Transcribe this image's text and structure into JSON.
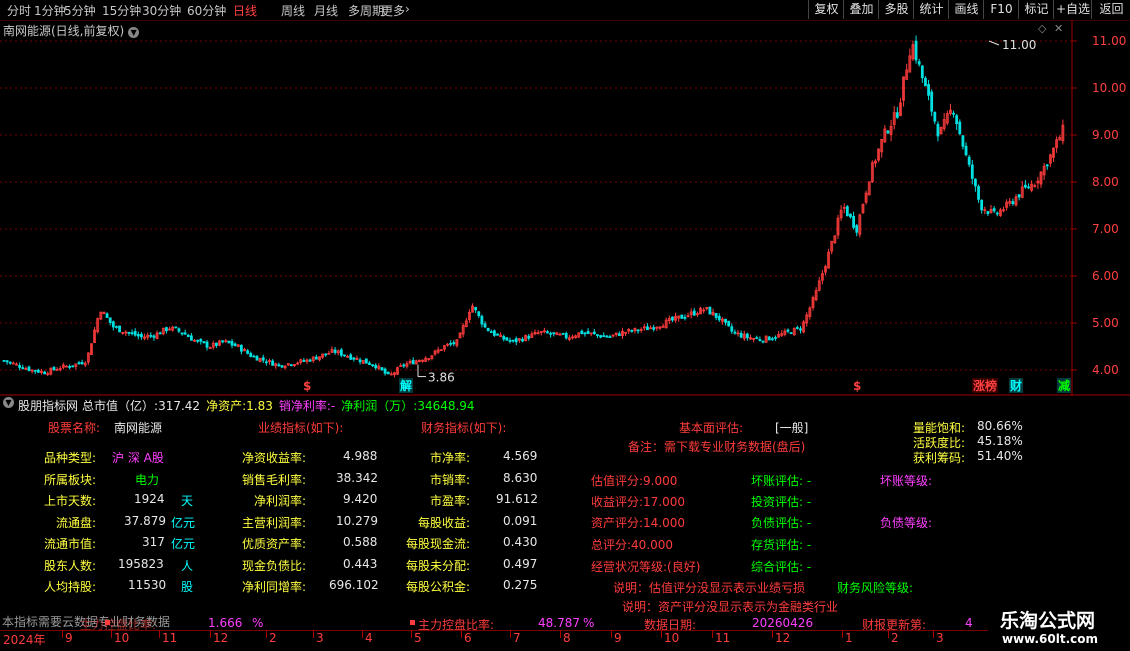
{
  "toolbar": {
    "periods": [
      "分时",
      "1分钟",
      "5分钟",
      "15分钟",
      "30分钟",
      "60分钟",
      "日线",
      "周线",
      "月线",
      "多周期",
      "更多"
    ],
    "selected": "日线",
    "buttons": [
      "复权",
      "叠加",
      "多股",
      "统计",
      "画线",
      "F10",
      "标记",
      "+自选",
      "返回"
    ]
  },
  "chart": {
    "title": "南网能源(日线,前复权)",
    "y_ticks": [
      "11.00",
      "10.00",
      "9.00",
      "8.00",
      "7.00",
      "6.00",
      "5.00",
      "4.00"
    ],
    "high_label": "11.00",
    "low_label": "3.86",
    "markers": [
      {
        "text": "$",
        "color": "#ff4040"
      },
      {
        "text": "解",
        "color": "#00ffff"
      },
      {
        "text": "$",
        "color": "#ff4040"
      },
      {
        "text": "涨榜",
        "color": "#ff4040"
      },
      {
        "text": "财",
        "color": "#00ffff"
      },
      {
        "text": "减",
        "color": "#00ff00"
      }
    ],
    "colors": {
      "up": "#ff3c3c",
      "down": "#00e0e0",
      "grid": "#7a0000",
      "axis": "#a00000"
    }
  },
  "chart_data": {
    "type": "candlestick",
    "title": "南网能源(日线,前复权)",
    "ylim": [
      3.7,
      11.2
    ],
    "approx_close_path": [
      4.2,
      4.1,
      4.0,
      3.95,
      4.05,
      4.1,
      4.2,
      5.3,
      4.9,
      4.8,
      4.7,
      4.75,
      4.9,
      4.8,
      4.6,
      4.5,
      4.6,
      4.5,
      4.3,
      4.2,
      4.1,
      4.15,
      4.2,
      4.3,
      4.4,
      4.3,
      4.2,
      4.1,
      3.86,
      4.1,
      4.2,
      4.3,
      4.5,
      4.6,
      5.4,
      4.9,
      4.7,
      4.6,
      4.7,
      4.8,
      4.75,
      4.7,
      4.8,
      4.75,
      4.7,
      4.8,
      4.85,
      4.9,
      5.0,
      5.1,
      5.2,
      5.3,
      5.1,
      4.8,
      4.7,
      4.65,
      4.7,
      4.8,
      4.9,
      5.6,
      6.5,
      7.5,
      7.0,
      8.2,
      9.0,
      9.5,
      11.0,
      10.0,
      9.0,
      9.6,
      8.5,
      7.5,
      7.3,
      7.5,
      7.8,
      8.0,
      8.5,
      9.1
    ]
  },
  "info": {
    "title": "股朋指标网",
    "header_pairs": [
      {
        "k": "总市值（亿）",
        "v": "317.42",
        "color": "#e8e8e8"
      },
      {
        "k": "净资产",
        "v": "1.83",
        "color": "#ffff40"
      },
      {
        "k": "销净利率",
        "v": "-",
        "color": "#ff40ff"
      },
      {
        "k": "净利润（万）",
        "v": "34648.94",
        "color": "#00ff00"
      }
    ],
    "stock_name_label": "股票名称:",
    "stock_name": "南网能源",
    "perf_header": "业绩指标(如下):",
    "fin_header": "财务指标(如下):",
    "fundamental_label": "基本面评估:",
    "fundamental_value": "[一般]",
    "note": "备注：需下载专业财务数据(盘后)",
    "left_rows": [
      {
        "k": "品种类型:",
        "v": "沪 深 A股",
        "u": ""
      },
      {
        "k": "所属板块:",
        "v": "电力",
        "u": ""
      },
      {
        "k": "上市天数:",
        "v": "1924",
        "u": "天"
      },
      {
        "k": "流通盘:",
        "v": "37.879",
        "u": "亿元"
      },
      {
        "k": "流通市值:",
        "v": "317",
        "u": "亿元"
      },
      {
        "k": "股东人数:",
        "v": "195823",
        "u": "人"
      },
      {
        "k": "人均持股:",
        "v": "11530",
        "u": "股"
      }
    ],
    "perf_rows": [
      {
        "k": "净资收益率:",
        "v": "4.988"
      },
      {
        "k": "销售毛利率:",
        "v": "38.342"
      },
      {
        "k": "净利润率:",
        "v": "9.420"
      },
      {
        "k": "主营利润率:",
        "v": "10.279"
      },
      {
        "k": "优质资产率:",
        "v": "0.588"
      },
      {
        "k": "现金负债比:",
        "v": "0.443"
      },
      {
        "k": "净利同增率:",
        "v": "696.102"
      }
    ],
    "fin_rows": [
      {
        "k": "市净率:",
        "v": "4.569"
      },
      {
        "k": "市销率:",
        "v": "8.630"
      },
      {
        "k": "市盈率:",
        "v": "91.612"
      },
      {
        "k": "每股收益:",
        "v": "0.091"
      },
      {
        "k": "每股现金流:",
        "v": "0.430"
      },
      {
        "k": "每股未分配:",
        "v": "0.497"
      },
      {
        "k": "每股公积金:",
        "v": "0.275"
      }
    ],
    "scores": [
      {
        "k": "估值评分:",
        "v": "9.000"
      },
      {
        "k": "收益评分:",
        "v": "17.000"
      },
      {
        "k": "资产评分:",
        "v": "14.000"
      },
      {
        "k": "总评分:",
        "v": "40.000"
      },
      {
        "k": "经营状况等级:",
        "v": "(良好)"
      }
    ],
    "evals": [
      "坏账评估: -",
      "投资评估: -",
      "负债评估: -",
      "存货评估: -",
      "综合评估: -"
    ],
    "right_stats": [
      {
        "k": "量能饱和:",
        "v": "80.66%"
      },
      {
        "k": "活跃度比:",
        "v": "45.18%"
      },
      {
        "k": "获利筹码:",
        "v": "51.40%"
      }
    ],
    "bad_debt_grade": "坏账等级:",
    "debt_grade": "负债等级:",
    "explain1": "说明：估值评分没显示表示业绩亏损",
    "explain2": "说明：资产评分没显示表示为金融类行业",
    "fin_risk": "财务风险等级:",
    "bottom_row": {
      "cloud_note": "本指标需要云数据专业财务数据",
      "overlap": "主力控盘比率:",
      "overlap_v": "1.666",
      "overlap_u": "%",
      "ctrl_label": "主力控盘比率:",
      "ctrl_v": "48.787",
      "ctrl_u": "%",
      "date_label": "数据日期:",
      "date_v": "20260426",
      "fin_upd_label": "财报更新第:",
      "fin_upd_v": "4"
    }
  },
  "timeline": {
    "year": "2024年",
    "months": [
      "9",
      "10",
      "11",
      "12",
      "2",
      "3",
      "4",
      "5",
      "6",
      "7",
      "8",
      "9",
      "10",
      "11",
      "12",
      "1",
      "2",
      "3"
    ]
  },
  "logo": {
    "name": "乐淘公式网",
    "url": "www.60lt.com"
  }
}
